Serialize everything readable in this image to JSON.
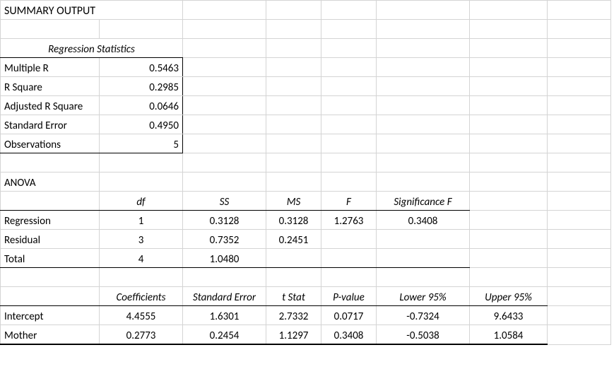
{
  "title": "SUMMARY OUTPUT",
  "regstats_header": "Regression Statistics",
  "regstats": {
    "r0_label": "Multiple R",
    "r0_val": "0.5463",
    "r1_label": "R Square",
    "r1_val": "0.2985",
    "r2_label": "Adjusted R Square",
    "r2_val": "0.0646",
    "r3_label": "Standard Error",
    "r3_val": "0.4950",
    "r4_label": "Observations",
    "r4_val": "5"
  },
  "anova_header": "ANOVA",
  "anova_cols": {
    "df": "df",
    "ss": "SS",
    "ms": "MS",
    "f": "F",
    "sigf": "Significance F"
  },
  "anova": {
    "r0_label": "Regression",
    "r0_df": "1",
    "r0_ss": "0.3128",
    "r0_ms": "0.3128",
    "r0_f": "1.2763",
    "r0_sigf": "0.3408",
    "r1_label": "Residual",
    "r1_df": "3",
    "r1_ss": "0.7352",
    "r1_ms": "0.2451",
    "r1_f": "",
    "r1_sigf": "",
    "r2_label": "Total",
    "r2_df": "4",
    "r2_ss": "1.0480",
    "r2_ms": "",
    "r2_f": "",
    "r2_sigf": ""
  },
  "coef_cols": {
    "coef": "Coefficients",
    "se": "Standard Error",
    "t": "t Stat",
    "p": "P-value",
    "lo": "Lower 95%",
    "hi": "Upper 95%"
  },
  "coef": {
    "r0_label": "Intercept",
    "r0_coef": "4.4555",
    "r0_se": "1.6301",
    "r0_t": "2.7332",
    "r0_p": "0.0717",
    "r0_lo": "-0.7324",
    "r0_hi": "9.6433",
    "r1_label": "Mother",
    "r1_coef": "0.2773",
    "r1_se": "0.2454",
    "r1_t": "1.1297",
    "r1_p": "0.3408",
    "r1_lo": "-0.5038",
    "r1_hi": "1.0584"
  }
}
